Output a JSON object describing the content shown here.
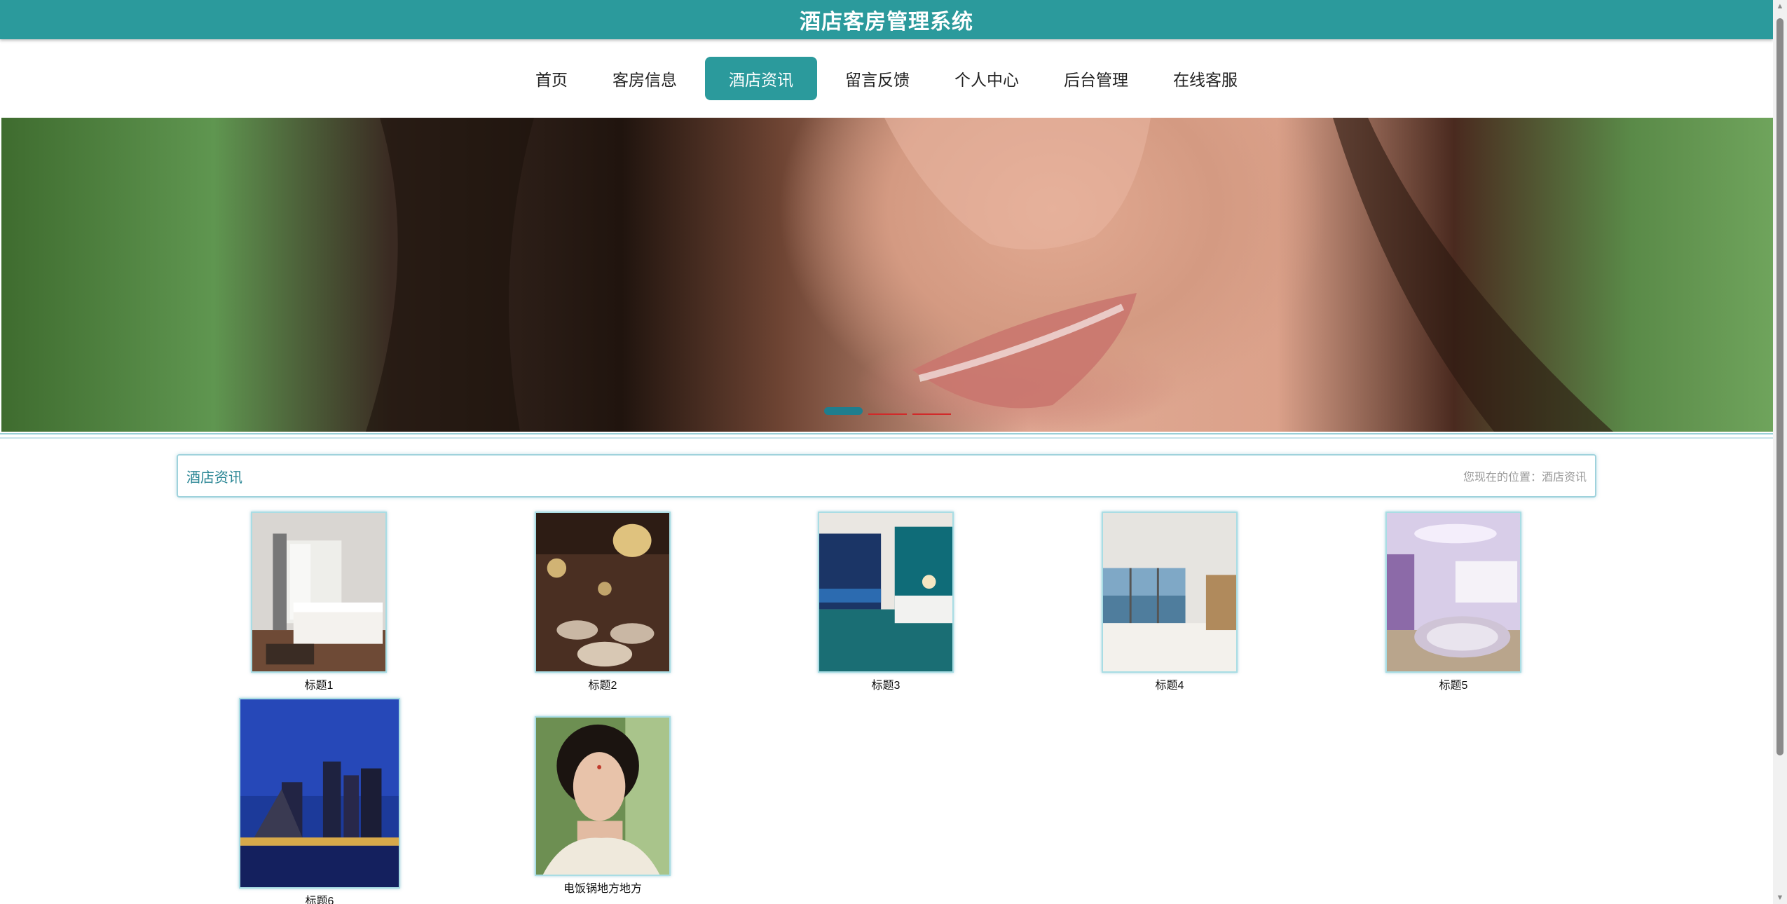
{
  "header": {
    "title": "酒店客房管理系统"
  },
  "nav": {
    "items": [
      {
        "label": "首页"
      },
      {
        "label": "客房信息"
      },
      {
        "label": "酒店资讯"
      },
      {
        "label": "留言反馈"
      },
      {
        "label": "个人中心"
      },
      {
        "label": "后台管理"
      },
      {
        "label": "在线客服"
      }
    ],
    "active_index": 2
  },
  "banner": {
    "slide_count": 3,
    "active_slide": 1
  },
  "section": {
    "title": "酒店资讯",
    "breadcrumb": "您现在的位置：酒店资讯"
  },
  "news": [
    {
      "caption": "标题1",
      "image": "hotel-bedroom-image"
    },
    {
      "caption": "标题2",
      "image": "banquet-hall-image"
    },
    {
      "caption": "标题3",
      "image": "teal-suite-image"
    },
    {
      "caption": "标题4",
      "image": "seaview-room-image"
    },
    {
      "caption": "标题5",
      "image": "purple-bath-suite-image"
    },
    {
      "caption": "标题6",
      "image": "night-city-image"
    },
    {
      "caption": "电饭锅地方地方",
      "image": "portrait-image"
    }
  ],
  "colors": {
    "primary": "#2b9a9c",
    "accent_border": "#9fd2dc",
    "dot_inactive": "#d12a2a"
  }
}
